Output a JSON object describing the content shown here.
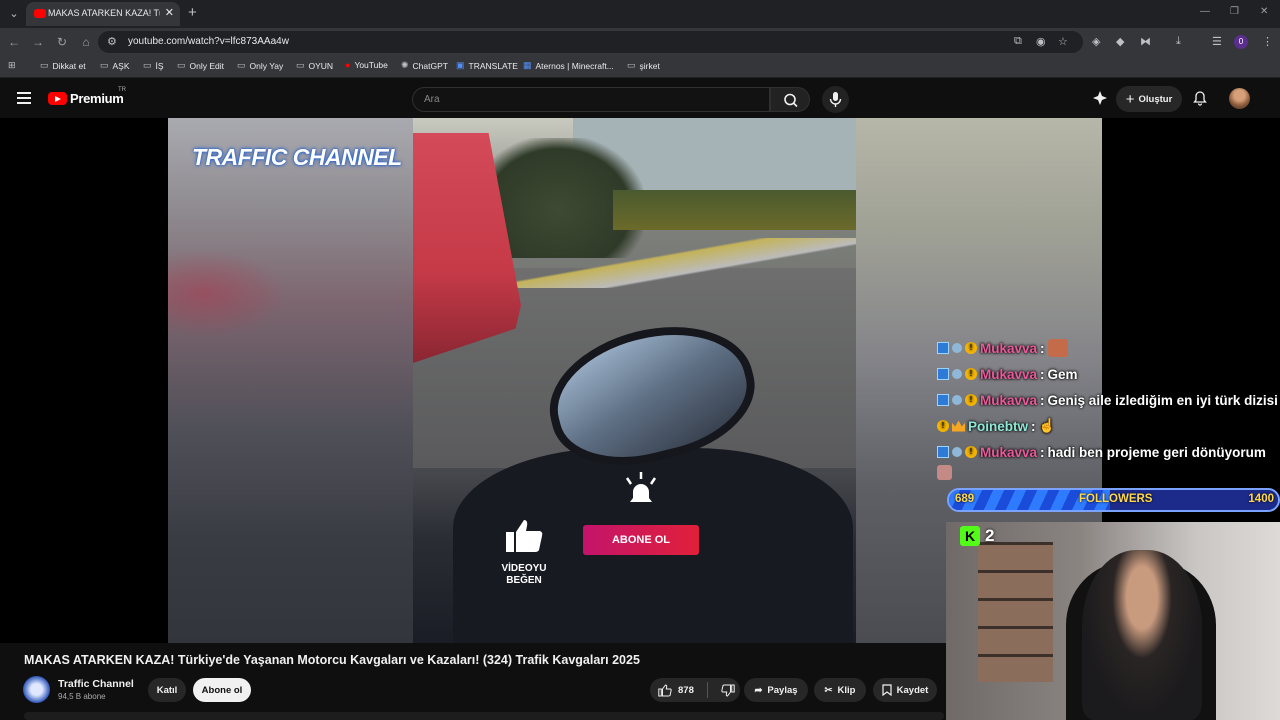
{
  "browser": {
    "tab_title": "MAKAS ATARKEN KAZA! Türkiye",
    "url": "youtube.com/watch?v=lfc873AAa4w",
    "profile_initial": "0"
  },
  "bookmarks": [
    {
      "label": "Dikkat et",
      "icon": "folder-icon"
    },
    {
      "label": "AŞK",
      "icon": "folder-icon"
    },
    {
      "label": "İŞ",
      "icon": "folder-icon"
    },
    {
      "label": "Only Edit",
      "icon": "folder-icon"
    },
    {
      "label": "Only Yay",
      "icon": "folder-icon"
    },
    {
      "label": "OYUN",
      "icon": "folder-icon"
    },
    {
      "label": "YouTube",
      "icon": "youtube-icon"
    },
    {
      "label": "ChatGPT",
      "icon": "chatgpt-icon"
    },
    {
      "label": "TRANSLATE",
      "icon": "translate-icon"
    },
    {
      "label": "Aternos | Minecraft...",
      "icon": "aternos-icon"
    },
    {
      "label": "şirket",
      "icon": "folder-icon"
    }
  ],
  "youtube": {
    "logo_text": "Premium",
    "country": "TR",
    "search_placeholder": "Ara",
    "create_label": "Oluştur"
  },
  "video": {
    "watermark": "TRAFFIC CHANNEL",
    "like_cta": "VİDEOYU BEĞEN",
    "subscribe_cta": "ABONE OL",
    "title": "MAKAS ATARKEN KAZA! Türkiye'de Yaşanan Motorcu Kavgaları ve Kazaları! (324) Trafik Kavgaları 2025",
    "channel_name": "Traffic Channel",
    "subscribers": "94,5 B abone",
    "join_label": "Katıl",
    "subscribe_label": "Abone ol",
    "likes": "878",
    "share_label": "Paylaş",
    "clip_label": "Klip",
    "save_label": "Kaydet"
  },
  "overlay": {
    "chat": [
      {
        "user": "Mukavva",
        "message": "",
        "emote": true,
        "color": "#e85a9a"
      },
      {
        "user": "Mukavva",
        "message": "Gem",
        "emote": false,
        "color": "#e85a9a"
      },
      {
        "user": "Mukavva",
        "message": "Geniş aile izlediğim en iyi türk dizisi",
        "emote": false,
        "color": "#e85a9a"
      },
      {
        "user": "Poinebtw",
        "message": "",
        "emote": false,
        "color": "#8fe8d6"
      },
      {
        "user": "Mukavva",
        "message": "hadi ben projeme geri dönüyorum",
        "emote": false,
        "color": "#e85a9a"
      }
    ],
    "followers_current": "689",
    "followers_label": "FOLLOWERS",
    "followers_goal": "1400",
    "followers_progress": 0.49,
    "kick_label": "K",
    "kick_count": "2"
  }
}
